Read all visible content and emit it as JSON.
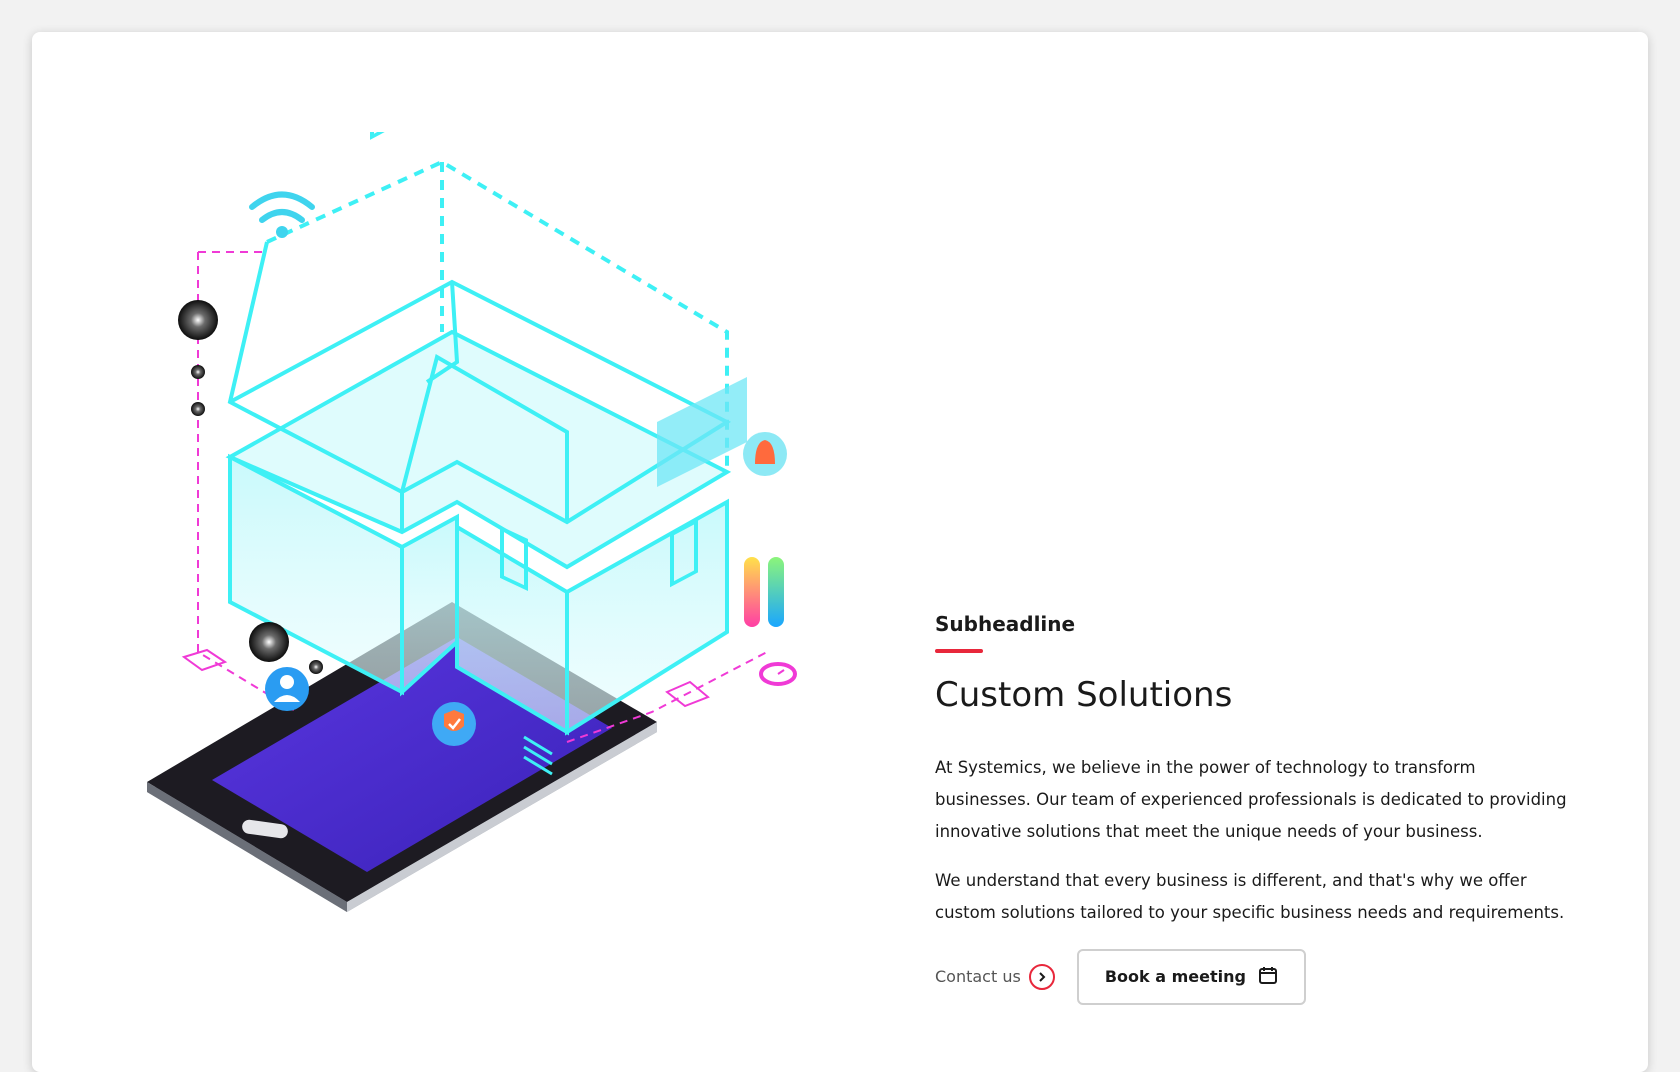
{
  "section": {
    "subheadline": "Subheadline",
    "title": "Custom Solutions",
    "paragraphs": [
      "At Systemics, we believe in the power of technology to transform businesses. Our team of experienced professionals is dedicated to providing innovative solutions that meet the unique needs of your business.",
      "We understand that every business is different, and that's why we offer custom solutions tailored to your specific business needs and requirements."
    ],
    "contact_label": "Contact us",
    "book_label": "Book a meeting"
  },
  "colors": {
    "accent": "#e8273b",
    "text": "#1a1a1a",
    "illustration_cyan": "#3ef0f5",
    "illustration_magenta": "#f03ad6",
    "tablet_screen": "#4a2fd0"
  },
  "icons": [
    "wifi-icon",
    "bell-icon",
    "user-icon",
    "shield-check-icon",
    "clock-icon",
    "arrow-right-icon",
    "calendar-icon"
  ]
}
